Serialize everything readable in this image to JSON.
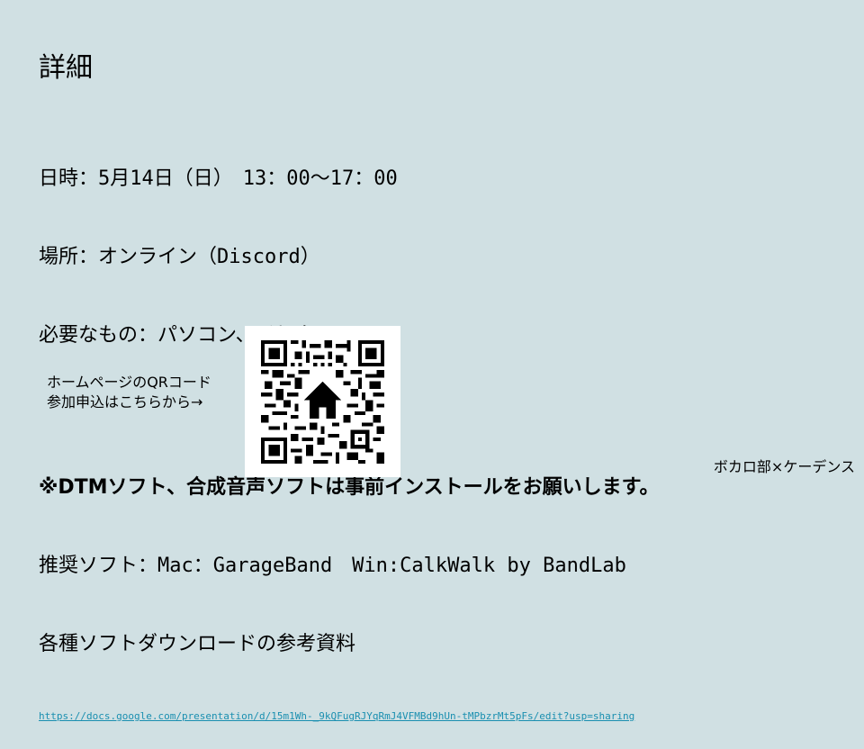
{
  "slide": {
    "title": "詳細",
    "datetime": "日時：5月14日（日）　13：00〜17：00",
    "place": "場所：オンライン（Discord）",
    "items": "必要なもの：パソコン、イヤホン",
    "notice": "※DTMソフト、合成音声ソフトは事前インストールをお願いします。",
    "recommended": "推奨ソフト：Mac：GarageBand　Win:CalkWalk by BandLab",
    "materials": "各種ソフトダウンロードの参考資料",
    "link": "https://docs.google.com/presentation/d/15m1Wh-_9kQFugRJYqRmJ4VFMBd9hUn-tMPbzrMt5pFs/edit?usp=sharing",
    "qr_caption_line1": "ホームページのQRコード",
    "qr_caption_line2": "参加申込はこちらから→",
    "footer": "ボカロ部×ケーデンス"
  },
  "icons": {
    "qr": "qr-code-icon",
    "home": "home-icon"
  }
}
